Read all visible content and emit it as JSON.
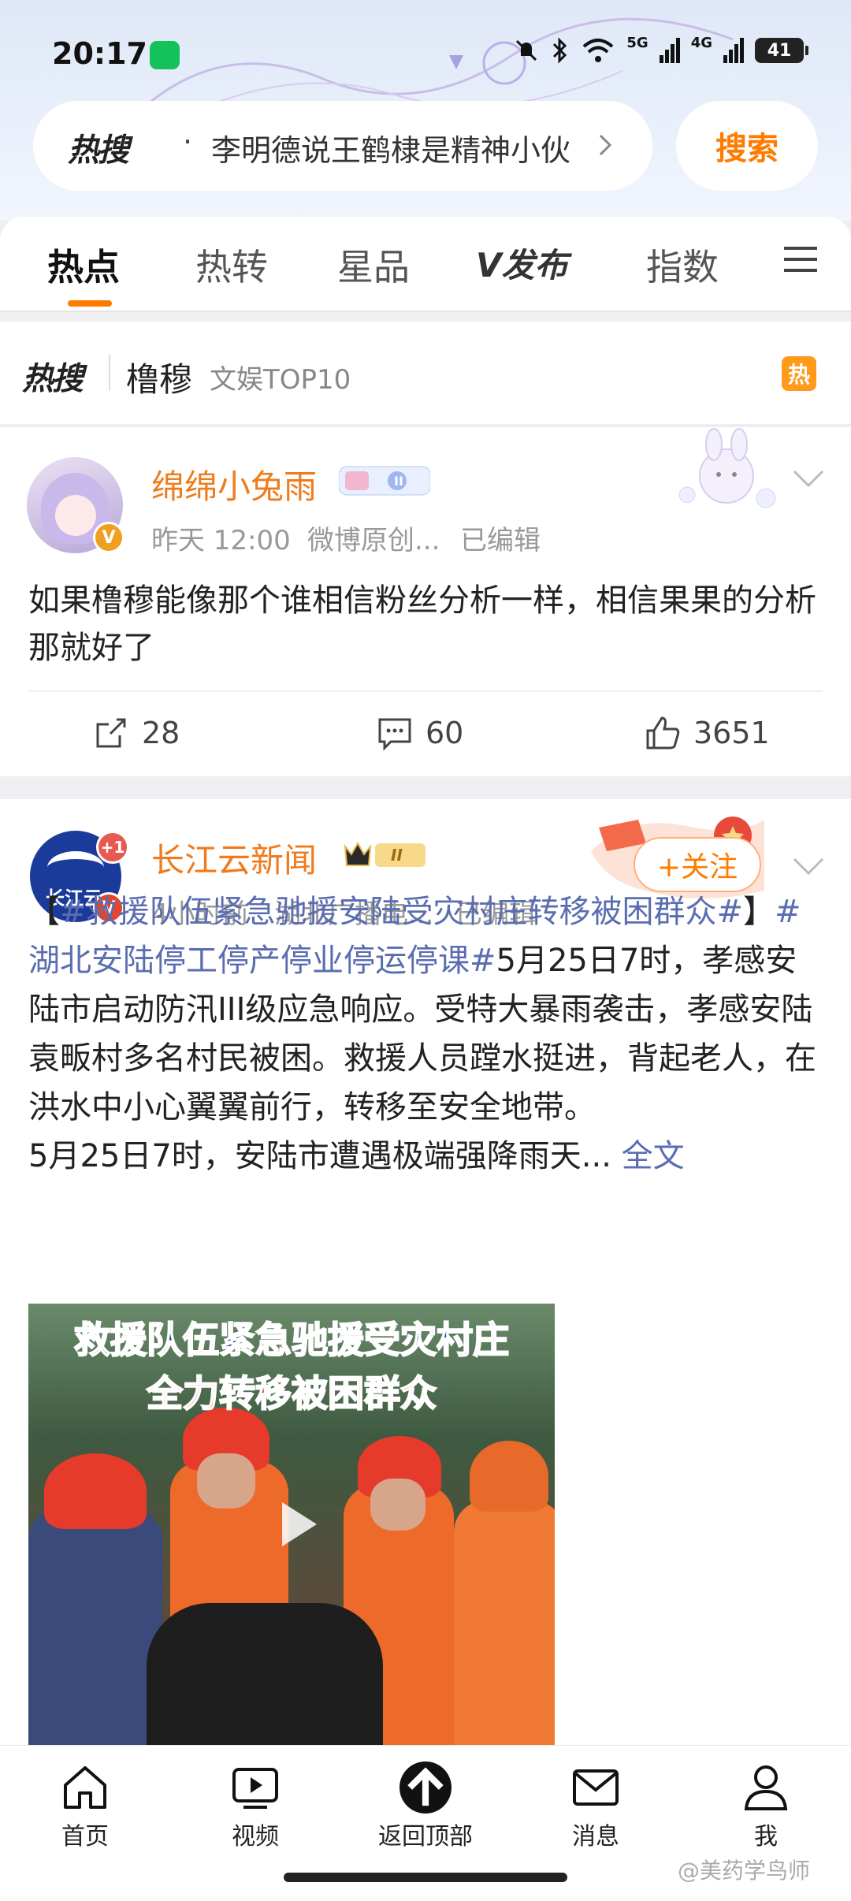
{
  "status": {
    "time": "20:17",
    "battery": "41",
    "signal1": "5G",
    "signal2": "4G"
  },
  "search": {
    "logo": "热搜",
    "dot": "·",
    "hot_query": "李明德说王鹤棣是精神小伙",
    "button": "搜索"
  },
  "tabs": [
    "热点",
    "热转",
    "星品",
    "V发布",
    "指数"
  ],
  "topic": {
    "logo": "热搜",
    "name": "橹穆",
    "tag": "文娱TOP10",
    "badge": "热"
  },
  "post1": {
    "author": "绵绵小兔雨",
    "time": "昨天 12:00",
    "source": "微博原创...",
    "edited": "已编辑",
    "text": "如果橹穆能像那个谁相信粉丝分析一样，相信果果的分析那就好了",
    "reposts": "28",
    "comments": "60",
    "likes": "3651"
  },
  "post2": {
    "author": "长江云新闻",
    "avatar_badge": "+1",
    "time": "4小时前",
    "source": "湖北广播电...",
    "edited": "已编辑",
    "follow": "+关注",
    "bracket_open": "【",
    "tag1": "#救援队伍紧急驰援安陆受灾村庄转移被困群众#",
    "bracket_close": "】",
    "tag2": "#湖北安陆停工停产停业停运停课#",
    "body": "5月25日7时，孝感安陆市启动防汛III级应急响应。受特大暴雨袭击，孝感安陆袁畈村多名村民被困。救援人员蹚水挺进，背起老人，在洪水中小心翼翼前行，转移至安全地带。",
    "body2": "5月25日7时，安陆市遭遇极端强降雨天... ",
    "more": "全文",
    "video_title1": "救援队伍紧急驰援受灾村庄",
    "video_title2": "全力转移被困群众"
  },
  "tabbar": [
    "首页",
    "视频",
    "返回顶部",
    "消息",
    "我"
  ],
  "watermark": "@美药学鸟师",
  "colors": {
    "accent": "#ff7b00",
    "author": "#f07b1b",
    "link": "#5a6db0"
  }
}
